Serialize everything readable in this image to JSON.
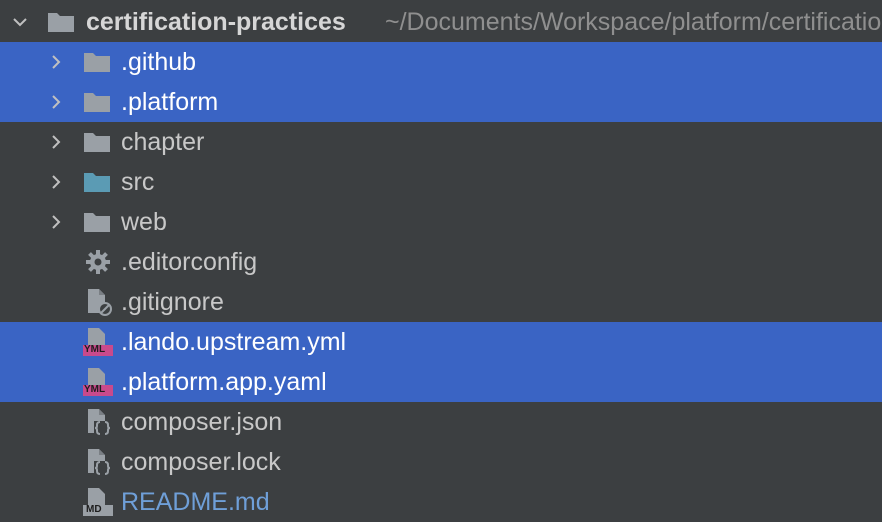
{
  "tree": {
    "root": {
      "name": "certification-practices",
      "path": "~/Documents/Workspace/platform/certification-practices",
      "icon": "folder-icon"
    },
    "items": [
      {
        "name": ".github",
        "type": "folder",
        "icon": "folder-icon",
        "expandable": true,
        "selected": true
      },
      {
        "name": ".platform",
        "type": "folder",
        "icon": "folder-icon",
        "expandable": true,
        "selected": true
      },
      {
        "name": "chapter",
        "type": "folder",
        "icon": "folder-icon",
        "expandable": true,
        "selected": false
      },
      {
        "name": "src",
        "type": "folder",
        "icon": "source-folder-icon",
        "expandable": true,
        "selected": false
      },
      {
        "name": "web",
        "type": "folder",
        "icon": "folder-icon",
        "expandable": true,
        "selected": false
      },
      {
        "name": ".editorconfig",
        "type": "file",
        "icon": "gear-icon",
        "expandable": false,
        "selected": false
      },
      {
        "name": ".gitignore",
        "type": "file",
        "icon": "ignore-file-icon",
        "expandable": false,
        "selected": false
      },
      {
        "name": ".lando.upstream.yml",
        "type": "file",
        "icon": "yml-file-icon",
        "badge": "YML",
        "expandable": false,
        "selected": true
      },
      {
        "name": ".platform.app.yaml",
        "type": "file",
        "icon": "yml-file-icon",
        "badge": "YML",
        "expandable": false,
        "selected": true
      },
      {
        "name": "composer.json",
        "type": "file",
        "icon": "json-file-icon",
        "expandable": false,
        "selected": false
      },
      {
        "name": "composer.lock",
        "type": "file",
        "icon": "json-file-icon",
        "expandable": false,
        "selected": false
      },
      {
        "name": "README.md",
        "type": "file",
        "icon": "markdown-file-icon",
        "badge": "MD",
        "expandable": false,
        "selected": false
      }
    ]
  },
  "colors": {
    "background": "#3c3f41",
    "selection": "#3a64c4",
    "folder": "#9aa0a6",
    "source_folder": "#5b9bb4",
    "yml_badge": "#c94a8c",
    "md_text": "#6f9fd8"
  }
}
